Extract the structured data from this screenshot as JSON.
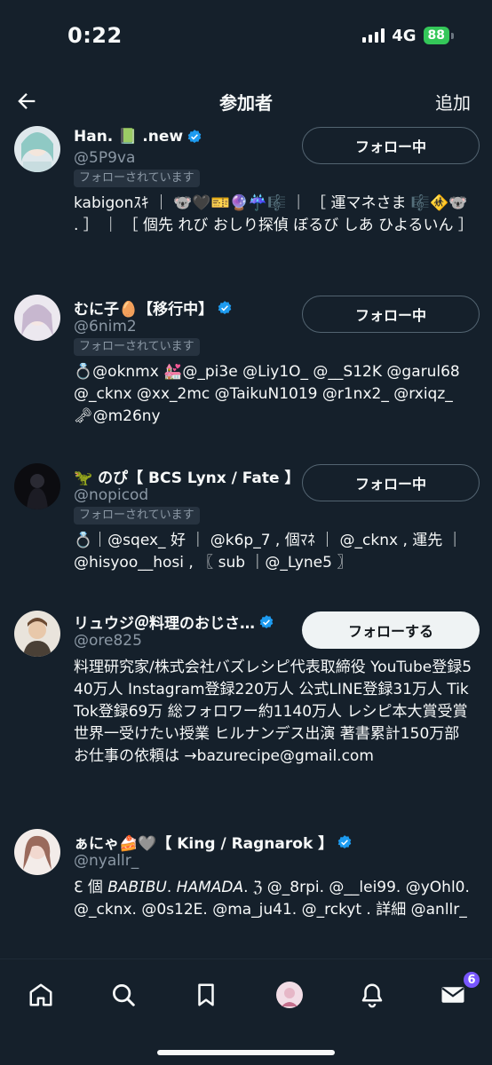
{
  "status": {
    "time": "0:22",
    "network": "4G",
    "battery": "88"
  },
  "header": {
    "title": "参加者",
    "action": "追加"
  },
  "users": [
    {
      "name": "Han. 📗 .new",
      "handle": "@5P9va",
      "follows_you": "フォローされています",
      "button": "フォロー中",
      "bio": "kabigonｽｷ ｜ 🐨🖤🎫🔮☔️🎼 ｜ ［ 運マネさま 🎼🚸🐨 . ］ ｜ ［ 個先 れび おしり探偵 ぼるび しあ ひよるいん ］"
    },
    {
      "name": "むに子🥚【移行中】",
      "handle": "@6nim2",
      "follows_you": "フォローされています",
      "button": "フォロー中",
      "bio": "💍@oknmx 💒@_pi3e @Liy1O_ @__S12K @garul68 @_cknx @xx_2mc @TaikuN1019 @r1nx2_ @rxiqz_ 🗝@m26ny"
    },
    {
      "name": "🦖 のぴ【 BCS Lynx / Fate 】",
      "handle": "@nopicod",
      "follows_you": "フォローされています",
      "button": "フォロー中",
      "bio": "💍｜@sqex_ 好 ｜ @k6p_7 , 個ﾏﾈ ｜ @_cknx , 運先 ｜@hisyoo__hosi , 〖 sub ｜@_Lyne5 〗"
    },
    {
      "name": "リュウジ＠料理のおじさ…",
      "handle": "@ore825",
      "follows_you": "",
      "button": "フォローする",
      "bio": "料理研究家/株式会社バズレシピ代表取締役 YouTube登録540万人 Instagram登録220万人 公式LINE登録31万人 TikTok登録69万 総フォロワー約1140万人 レシピ本大賞受賞 世界一受けたい授業 ヒルナンデス出演 著書累計150万部 お仕事の依頼は →bazurecipe@gmail.com"
    },
    {
      "name": "ぁにゃ🍰🩶【 King / Ragnarok 】",
      "handle": "@nyallr_",
      "follows_you": "",
      "button": "",
      "bio": "ℇ 個 𝘉𝘈𝘉𝘐𝘉𝘜. 𝘏𝘈𝘔𝘈𝘋𝘈. ℨ @_8rpi. @__lei99. @yOhl0. @_cknx. @0s12E. @ma_ju41. @_rckyt . 詳細 @anllr_"
    }
  ],
  "tabbar": {
    "icons": [
      "home-icon",
      "search-icon",
      "bookmark-icon",
      "profile-avatar",
      "bell-icon",
      "mail-icon"
    ],
    "mail_badge": "6"
  },
  "colors": {
    "background": "#15202b",
    "verified": "#1d9bf0",
    "badge": "#7856ff"
  }
}
